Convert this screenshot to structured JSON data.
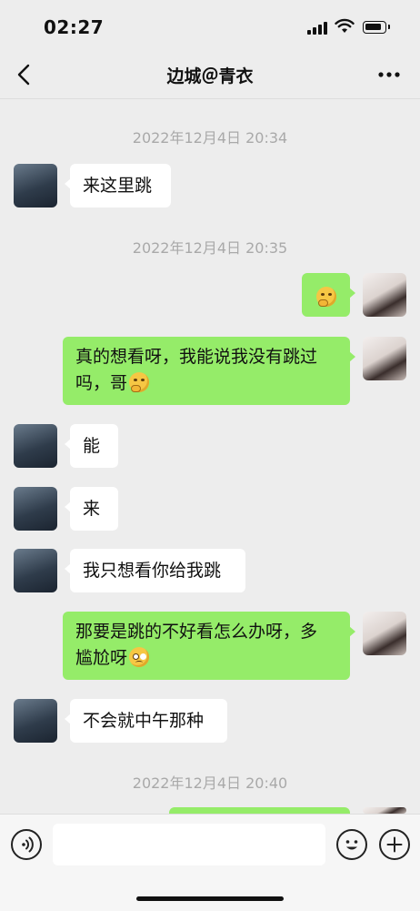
{
  "status_bar": {
    "time": "02:27"
  },
  "nav": {
    "title": "边城＠青衣"
  },
  "timestamps": [
    "2022年12月4日 20:34",
    "2022年12月4日 20:35",
    "2022年12月4日 20:40"
  ],
  "messages": [
    {
      "side": "left",
      "text": "来这里跳"
    },
    {
      "side": "right",
      "text": "",
      "emoji": "thinking-face"
    },
    {
      "side": "right",
      "line1": "真的想看呀，我能说我没有跳过",
      "line2": "吗，哥",
      "emoji": "thinking-face"
    },
    {
      "side": "left",
      "text": "能"
    },
    {
      "side": "left",
      "text": "来"
    },
    {
      "side": "left",
      "text": "我只想看你给我跳"
    },
    {
      "side": "right",
      "line1": "那要是跳的不好看怎么办呀，多",
      "line2": "尴尬呀",
      "emoji": "pleading-face"
    },
    {
      "side": "left",
      "text": "不会就中午那种"
    }
  ],
  "input_bar": {
    "placeholder": ""
  },
  "colors": {
    "background": "#ededed",
    "bubble_sent": "#95ec69",
    "bubble_received": "#ffffff",
    "timestamp": "#a9a9a9"
  },
  "icons": [
    "back-chevron",
    "more-dots",
    "voice",
    "emoji",
    "plus",
    "signal",
    "wifi",
    "battery"
  ]
}
